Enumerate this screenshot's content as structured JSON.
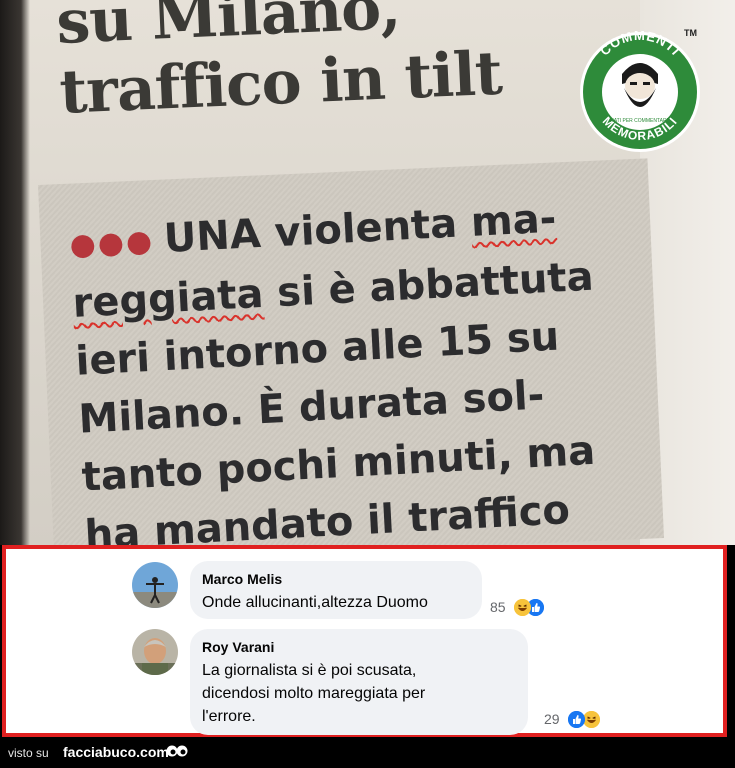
{
  "newspaper": {
    "headline_lines": [
      "su Milano,",
      "traffico in tilt"
    ],
    "article_lines": [
      "UNA violenta ma-",
      "reggiata si è abbattuta",
      "ieri intorno alle 15 su",
      "Milano. È durata sol-",
      "tanto pochi minuti, ma",
      "ha mandato il traffico"
    ],
    "article_first_word_plain": "UNA violenta ",
    "article_first_word_marked": "ma-",
    "article_second_marked": "reggiata",
    "article_second_plain": " si è abbattuta"
  },
  "logo": {
    "top_text": "COMMENTI",
    "bottom_text": "MEMORABILI",
    "tiny_text": "NATI PER COMMENTARE",
    "tm": "TM",
    "color": "#2e8b3a"
  },
  "comments": [
    {
      "name": "Marco Melis",
      "text": "Onde allucinanti,altezza Duomo",
      "reactions_count": "85",
      "reactions": [
        "laugh",
        "like"
      ]
    },
    {
      "name": "Roy Varani",
      "text_lines": [
        "La giornalista si è poi scusata,",
        "dicendosi molto mareggiata per",
        "l'errore."
      ],
      "reactions_count": "29",
      "reactions": [
        "like",
        "laugh"
      ]
    }
  ],
  "footer": {
    "visto_su": "visto su",
    "brand": "facciabuco.com"
  },
  "colors": {
    "highlight_border": "#e02020",
    "bubble_bg": "#f0f2f5",
    "like_blue": "#1877f2",
    "laugh_yellow": "#f7c33b"
  }
}
